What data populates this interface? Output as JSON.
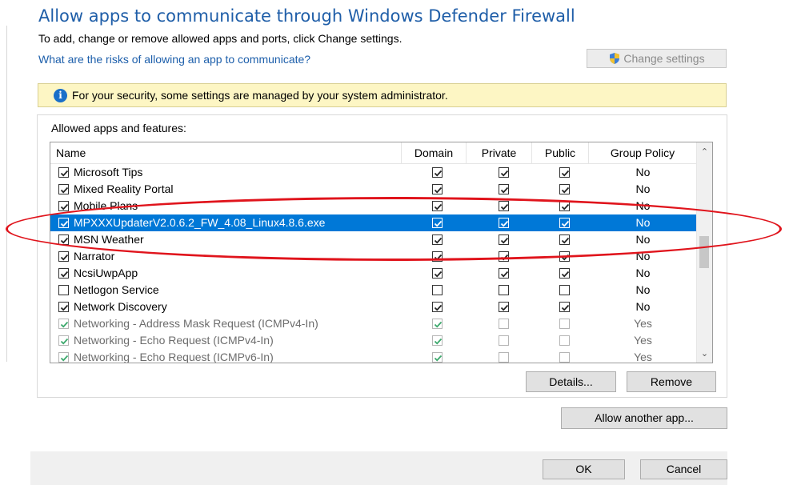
{
  "page": {
    "title": "Allow apps to communicate through Windows Defender Firewall",
    "subtitle": "To add, change or remove allowed apps and ports, click Change settings.",
    "risk_link": "What are the risks of allowing an app to communicate?",
    "change_settings": "Change settings"
  },
  "info_bar": {
    "text": "For your security, some settings are managed by your system administrator."
  },
  "group": {
    "label": "Allowed apps and features:"
  },
  "table": {
    "columns": [
      "Name",
      "Domain",
      "Private",
      "Public",
      "Group Policy"
    ],
    "rows": [
      {
        "name": "Microsoft Tips",
        "checked": true,
        "domain": true,
        "private": true,
        "public": true,
        "gp": "No",
        "selected": false,
        "dim": false
      },
      {
        "name": "Mixed Reality Portal",
        "checked": true,
        "domain": true,
        "private": true,
        "public": true,
        "gp": "No",
        "selected": false,
        "dim": false
      },
      {
        "name": "Mobile Plans",
        "checked": true,
        "domain": true,
        "private": true,
        "public": true,
        "gp": "No",
        "selected": false,
        "dim": false
      },
      {
        "name": "MPXXXUpdaterV2.0.6.2_FW_4.08_Linux4.8.6.exe",
        "checked": true,
        "domain": true,
        "private": true,
        "public": true,
        "gp": "No",
        "selected": true,
        "dim": false
      },
      {
        "name": "MSN Weather",
        "checked": true,
        "domain": true,
        "private": true,
        "public": true,
        "gp": "No",
        "selected": false,
        "dim": false
      },
      {
        "name": "Narrator",
        "checked": true,
        "domain": true,
        "private": true,
        "public": true,
        "gp": "No",
        "selected": false,
        "dim": false
      },
      {
        "name": "NcsiUwpApp",
        "checked": true,
        "domain": true,
        "private": true,
        "public": true,
        "gp": "No",
        "selected": false,
        "dim": false
      },
      {
        "name": "Netlogon Service",
        "checked": false,
        "domain": false,
        "private": false,
        "public": false,
        "gp": "No",
        "selected": false,
        "dim": false
      },
      {
        "name": "Network Discovery",
        "checked": true,
        "domain": true,
        "private": true,
        "public": true,
        "gp": "No",
        "selected": false,
        "dim": false
      },
      {
        "name": "Networking - Address Mask Request (ICMPv4-In)",
        "checked": true,
        "domain": true,
        "private": false,
        "public": false,
        "gp": "Yes",
        "selected": false,
        "dim": true
      },
      {
        "name": "Networking - Echo Request (ICMPv4-In)",
        "checked": true,
        "domain": true,
        "private": false,
        "public": false,
        "gp": "Yes",
        "selected": false,
        "dim": true
      },
      {
        "name": "Networking - Echo Request (ICMPv6-In)",
        "checked": true,
        "domain": true,
        "private": false,
        "public": false,
        "gp": "Yes",
        "selected": false,
        "dim": true
      }
    ]
  },
  "buttons": {
    "details": "Details...",
    "remove": "Remove",
    "allow_another": "Allow another app...",
    "ok": "OK",
    "cancel": "Cancel"
  },
  "icons": {
    "shield": "uac-shield-icon",
    "info": "info-icon",
    "scroll_up": "chevron-up-icon",
    "scroll_down": "chevron-down-icon"
  },
  "colors": {
    "title": "#1f5ea8",
    "link": "#1d5fab",
    "selection": "#0078d7",
    "info_bar": "#fdf6c4",
    "highlight_ellipse": "#e0141c"
  }
}
